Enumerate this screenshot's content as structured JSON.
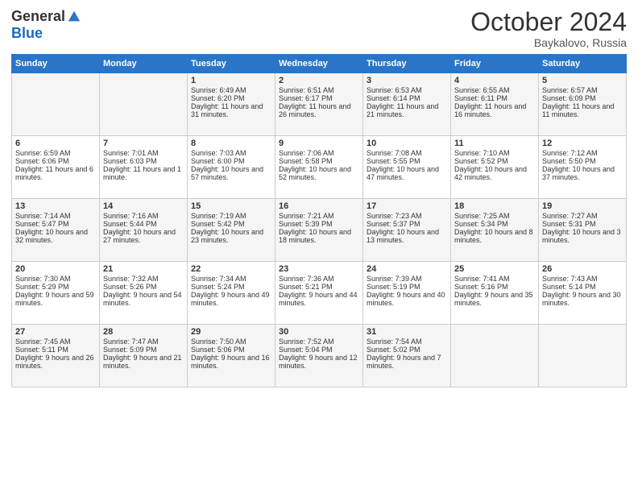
{
  "logo": {
    "general": "General",
    "blue": "Blue"
  },
  "header": {
    "month": "October 2024",
    "location": "Baykalovo, Russia"
  },
  "days": [
    "Sunday",
    "Monday",
    "Tuesday",
    "Wednesday",
    "Thursday",
    "Friday",
    "Saturday"
  ],
  "weeks": [
    [
      {
        "day": "",
        "sunrise": "",
        "sunset": "",
        "daylight": ""
      },
      {
        "day": "",
        "sunrise": "",
        "sunset": "",
        "daylight": ""
      },
      {
        "day": "1",
        "sunrise": "Sunrise: 6:49 AM",
        "sunset": "Sunset: 6:20 PM",
        "daylight": "Daylight: 11 hours and 31 minutes."
      },
      {
        "day": "2",
        "sunrise": "Sunrise: 6:51 AM",
        "sunset": "Sunset: 6:17 PM",
        "daylight": "Daylight: 11 hours and 26 minutes."
      },
      {
        "day": "3",
        "sunrise": "Sunrise: 6:53 AM",
        "sunset": "Sunset: 6:14 PM",
        "daylight": "Daylight: 11 hours and 21 minutes."
      },
      {
        "day": "4",
        "sunrise": "Sunrise: 6:55 AM",
        "sunset": "Sunset: 6:11 PM",
        "daylight": "Daylight: 11 hours and 16 minutes."
      },
      {
        "day": "5",
        "sunrise": "Sunrise: 6:57 AM",
        "sunset": "Sunset: 6:09 PM",
        "daylight": "Daylight: 11 hours and 11 minutes."
      }
    ],
    [
      {
        "day": "6",
        "sunrise": "Sunrise: 6:59 AM",
        "sunset": "Sunset: 6:06 PM",
        "daylight": "Daylight: 11 hours and 6 minutes."
      },
      {
        "day": "7",
        "sunrise": "Sunrise: 7:01 AM",
        "sunset": "Sunset: 6:03 PM",
        "daylight": "Daylight: 11 hours and 1 minute."
      },
      {
        "day": "8",
        "sunrise": "Sunrise: 7:03 AM",
        "sunset": "Sunset: 6:00 PM",
        "daylight": "Daylight: 10 hours and 57 minutes."
      },
      {
        "day": "9",
        "sunrise": "Sunrise: 7:06 AM",
        "sunset": "Sunset: 5:58 PM",
        "daylight": "Daylight: 10 hours and 52 minutes."
      },
      {
        "day": "10",
        "sunrise": "Sunrise: 7:08 AM",
        "sunset": "Sunset: 5:55 PM",
        "daylight": "Daylight: 10 hours and 47 minutes."
      },
      {
        "day": "11",
        "sunrise": "Sunrise: 7:10 AM",
        "sunset": "Sunset: 5:52 PM",
        "daylight": "Daylight: 10 hours and 42 minutes."
      },
      {
        "day": "12",
        "sunrise": "Sunrise: 7:12 AM",
        "sunset": "Sunset: 5:50 PM",
        "daylight": "Daylight: 10 hours and 37 minutes."
      }
    ],
    [
      {
        "day": "13",
        "sunrise": "Sunrise: 7:14 AM",
        "sunset": "Sunset: 5:47 PM",
        "daylight": "Daylight: 10 hours and 32 minutes."
      },
      {
        "day": "14",
        "sunrise": "Sunrise: 7:16 AM",
        "sunset": "Sunset: 5:44 PM",
        "daylight": "Daylight: 10 hours and 27 minutes."
      },
      {
        "day": "15",
        "sunrise": "Sunrise: 7:19 AM",
        "sunset": "Sunset: 5:42 PM",
        "daylight": "Daylight: 10 hours and 23 minutes."
      },
      {
        "day": "16",
        "sunrise": "Sunrise: 7:21 AM",
        "sunset": "Sunset: 5:39 PM",
        "daylight": "Daylight: 10 hours and 18 minutes."
      },
      {
        "day": "17",
        "sunrise": "Sunrise: 7:23 AM",
        "sunset": "Sunset: 5:37 PM",
        "daylight": "Daylight: 10 hours and 13 minutes."
      },
      {
        "day": "18",
        "sunrise": "Sunrise: 7:25 AM",
        "sunset": "Sunset: 5:34 PM",
        "daylight": "Daylight: 10 hours and 8 minutes."
      },
      {
        "day": "19",
        "sunrise": "Sunrise: 7:27 AM",
        "sunset": "Sunset: 5:31 PM",
        "daylight": "Daylight: 10 hours and 3 minutes."
      }
    ],
    [
      {
        "day": "20",
        "sunrise": "Sunrise: 7:30 AM",
        "sunset": "Sunset: 5:29 PM",
        "daylight": "Daylight: 9 hours and 59 minutes."
      },
      {
        "day": "21",
        "sunrise": "Sunrise: 7:32 AM",
        "sunset": "Sunset: 5:26 PM",
        "daylight": "Daylight: 9 hours and 54 minutes."
      },
      {
        "day": "22",
        "sunrise": "Sunrise: 7:34 AM",
        "sunset": "Sunset: 5:24 PM",
        "daylight": "Daylight: 9 hours and 49 minutes."
      },
      {
        "day": "23",
        "sunrise": "Sunrise: 7:36 AM",
        "sunset": "Sunset: 5:21 PM",
        "daylight": "Daylight: 9 hours and 44 minutes."
      },
      {
        "day": "24",
        "sunrise": "Sunrise: 7:39 AM",
        "sunset": "Sunset: 5:19 PM",
        "daylight": "Daylight: 9 hours and 40 minutes."
      },
      {
        "day": "25",
        "sunrise": "Sunrise: 7:41 AM",
        "sunset": "Sunset: 5:16 PM",
        "daylight": "Daylight: 9 hours and 35 minutes."
      },
      {
        "day": "26",
        "sunrise": "Sunrise: 7:43 AM",
        "sunset": "Sunset: 5:14 PM",
        "daylight": "Daylight: 9 hours and 30 minutes."
      }
    ],
    [
      {
        "day": "27",
        "sunrise": "Sunrise: 7:45 AM",
        "sunset": "Sunset: 5:11 PM",
        "daylight": "Daylight: 9 hours and 26 minutes."
      },
      {
        "day": "28",
        "sunrise": "Sunrise: 7:47 AM",
        "sunset": "Sunset: 5:09 PM",
        "daylight": "Daylight: 9 hours and 21 minutes."
      },
      {
        "day": "29",
        "sunrise": "Sunrise: 7:50 AM",
        "sunset": "Sunset: 5:06 PM",
        "daylight": "Daylight: 9 hours and 16 minutes."
      },
      {
        "day": "30",
        "sunrise": "Sunrise: 7:52 AM",
        "sunset": "Sunset: 5:04 PM",
        "daylight": "Daylight: 9 hours and 12 minutes."
      },
      {
        "day": "31",
        "sunrise": "Sunrise: 7:54 AM",
        "sunset": "Sunset: 5:02 PM",
        "daylight": "Daylight: 9 hours and 7 minutes."
      },
      {
        "day": "",
        "sunrise": "",
        "sunset": "",
        "daylight": ""
      },
      {
        "day": "",
        "sunrise": "",
        "sunset": "",
        "daylight": ""
      }
    ]
  ]
}
